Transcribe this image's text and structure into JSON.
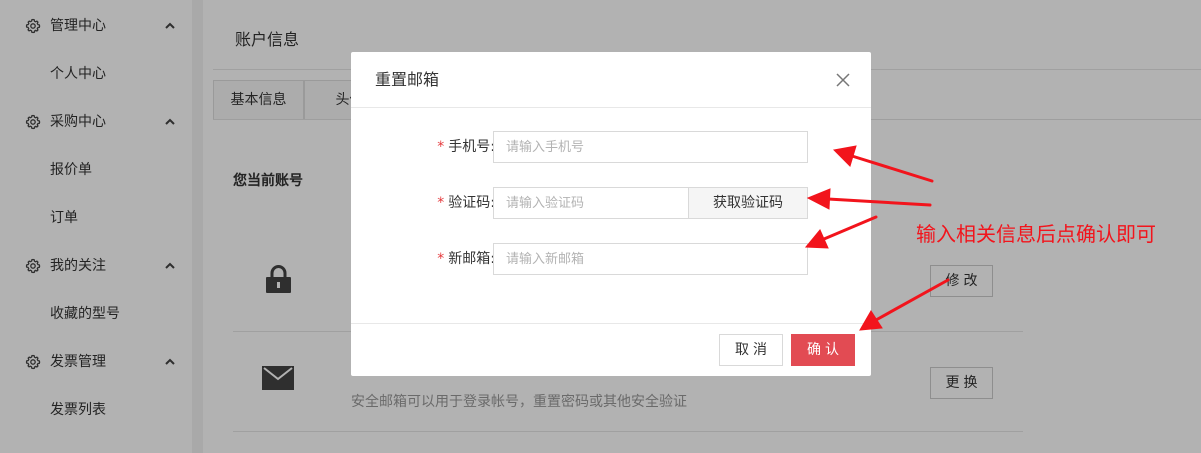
{
  "sidebar": {
    "groups": [
      {
        "label": "管理中心",
        "items": [
          "个人中心"
        ]
      },
      {
        "label": "采购中心",
        "items": [
          "报价单",
          "订单"
        ]
      },
      {
        "label": "我的关注",
        "items": [
          "收藏的型号"
        ]
      },
      {
        "label": "发票管理",
        "items": [
          "发票列表"
        ]
      }
    ],
    "icons": {
      "group": "gear-icon",
      "toggle": "chevron-up-icon"
    }
  },
  "main": {
    "title": "账户信息",
    "tabs": [
      "基本信息",
      "头像"
    ],
    "account_label": "您当前账号",
    "rows": [
      {
        "icon": "lock-icon",
        "button": "修改"
      },
      {
        "icon": "mail-icon",
        "description": "安全邮箱可以用于登录帐号，重置密码或其他安全验证",
        "button": "更换"
      }
    ]
  },
  "modal": {
    "title": "重置邮箱",
    "close_icon": "close-icon",
    "required_mark": "*",
    "fields": {
      "phone": {
        "label": "手机号:",
        "placeholder": "请输入手机号",
        "value": ""
      },
      "code": {
        "label": "验证码:",
        "placeholder": "请输入验证码",
        "value": "",
        "button": "获取验证码"
      },
      "email": {
        "label": "新邮箱:",
        "placeholder": "请输入新邮箱",
        "value": ""
      }
    },
    "cancel_label": "取消",
    "ok_label": "确认"
  },
  "annotation": {
    "text": "输入相关信息后点确认即可",
    "color": "#f2141c"
  },
  "colors": {
    "primary": "#e24b53",
    "required": "#e4393c"
  }
}
